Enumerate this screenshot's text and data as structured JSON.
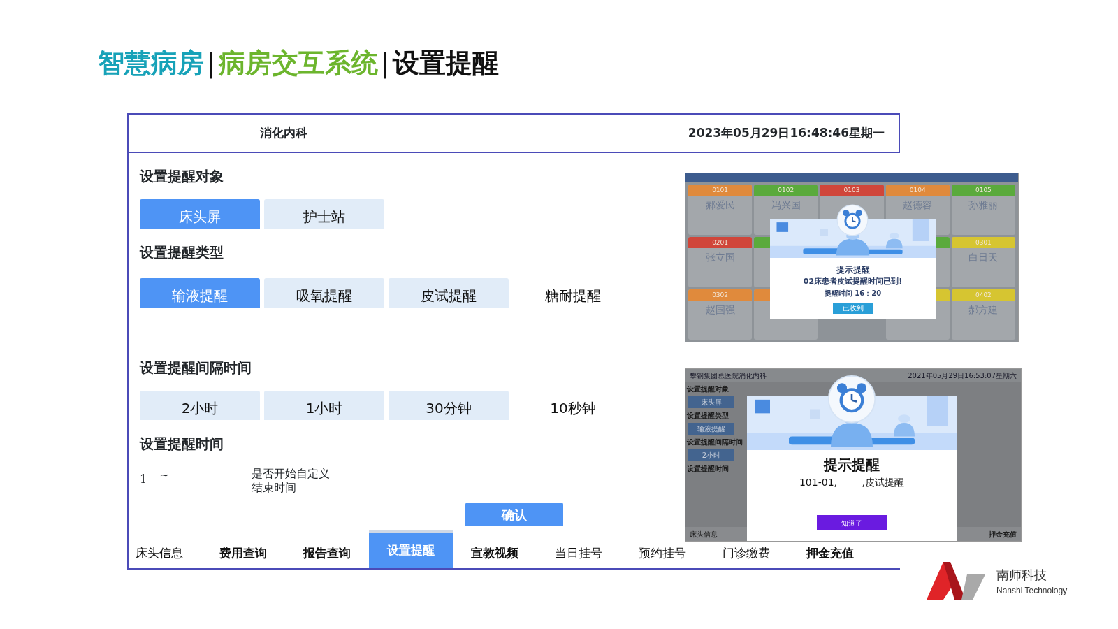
{
  "slide_title": [
    {
      "kind": "text",
      "text": "智慧病房",
      "color": "#17a2b8"
    },
    {
      "kind": "separator",
      "text": "|",
      "color": "#111111"
    },
    {
      "kind": "text",
      "text": "病房交互系统",
      "color": "#6cb52d"
    },
    {
      "kind": "separator",
      "text": "|",
      "color": "#111111"
    },
    {
      "kind": "text",
      "text": "设置提醒",
      "color": "#111111"
    }
  ],
  "header": {
    "department": "消化内科",
    "datetime": "2023年05月29日16:48:46星期一"
  },
  "sections": [
    {
      "heading": "设置提醒对象",
      "options": [
        {
          "label": "床头屏",
          "kind": "tile",
          "selected": true
        },
        {
          "label": "护士站",
          "kind": "tile",
          "selected": false
        }
      ]
    },
    {
      "heading": "设置提醒类型",
      "options": [
        {
          "label": "输液提醒",
          "kind": "tile",
          "selected": true
        },
        {
          "label": "吸氧提醒",
          "kind": "tile",
          "selected": false
        },
        {
          "label": "皮试提醒",
          "kind": "tile",
          "selected": false
        },
        {
          "label": "糖耐提醒",
          "kind": "plain",
          "selected": false
        }
      ]
    },
    {
      "heading": "设置提醒间隔时间",
      "options": [
        {
          "label": "2小时",
          "kind": "tile",
          "selected": false
        },
        {
          "label": "1小时",
          "kind": "tile",
          "selected": false
        },
        {
          "label": "30分钟",
          "kind": "tile",
          "selected": false
        },
        {
          "label": "10秒钟",
          "kind": "plain",
          "selected": false
        }
      ]
    },
    {
      "heading": "设置提醒时间"
    }
  ],
  "time_row": {
    "start": "1",
    "separator": "~",
    "custom_end_label": "是否开始自定义结束时间"
  },
  "confirm_button": "确认",
  "bottom_nav": [
    {
      "label": "床头信息",
      "bold": false,
      "selected": false
    },
    {
      "label": "费用查询",
      "bold": true,
      "selected": false
    },
    {
      "label": "报告查询",
      "bold": true,
      "selected": false
    },
    {
      "label": "设置提醒",
      "bold": true,
      "selected": true
    },
    {
      "label": "宣教视频",
      "bold": true,
      "selected": false
    },
    {
      "label": "当日挂号",
      "bold": false,
      "selected": false
    },
    {
      "label": "预约挂号",
      "bold": false,
      "selected": false
    },
    {
      "label": "门诊缴费",
      "bold": false,
      "selected": false
    },
    {
      "label": "押金充值",
      "bold": true,
      "selected": false
    }
  ],
  "nurse_station_screenshot": {
    "bed_rows": [
      [
        {
          "number": "0101",
          "name": "郝爱民",
          "color": "#e08a3c"
        },
        {
          "number": "0102",
          "name": "冯兴国",
          "color": "#5aaa3c"
        },
        {
          "number": "0103",
          "color": "#d0463a"
        },
        {
          "number": "0104",
          "name": "赵德容",
          "color": "#e08a3c"
        },
        {
          "number": "0105",
          "name": "孙雅丽",
          "color": "#5aaa3c"
        }
      ],
      [
        {
          "number": "0201",
          "name": "张立国",
          "color": "#d0463a"
        },
        {
          "color": "#5aaa3c"
        },
        {
          "color": "#5aaa3c"
        },
        {
          "number": "0301",
          "name": "白日天",
          "color": "#d6c531"
        }
      ],
      [
        {
          "number": "0302",
          "name": "赵国强",
          "color": "#e08a3c"
        },
        {
          "color": "#e08a3c"
        },
        {
          "color": "#d6c531"
        },
        {
          "number": "0402",
          "name": "郝方建",
          "color": "#d6c531"
        }
      ]
    ],
    "dialog": {
      "title": "提示提醒",
      "message": "02床患者皮试提醒时间已到!",
      "time": "提醒时间 16：20",
      "button": "已收到"
    }
  },
  "bedside_screenshot": {
    "hospital": "攀钢集团总医院消化内科",
    "datetime": "2021年05月29日16:53:07星期六",
    "background_texts": [
      {
        "text": "设置提醒对象",
        "kind": "heading"
      },
      {
        "text": "床头屏",
        "kind": "tile"
      },
      {
        "text": "设置提醒类型",
        "kind": "heading"
      },
      {
        "text": "输液提醒",
        "kind": "tile"
      },
      {
        "text": "设置提醒间隔时间",
        "kind": "heading"
      },
      {
        "text": "2小时",
        "kind": "tile"
      },
      {
        "text": "设置提醒时间",
        "kind": "heading"
      }
    ],
    "nav_left": "床头信息",
    "nav_right": "押金充值",
    "dialog": {
      "title": "提示提醒",
      "message": "101-01,        ,皮试提醒",
      "button": "知道了"
    }
  },
  "logo": {
    "name": "南师科技",
    "subtitle": "Nanshi Technology"
  }
}
